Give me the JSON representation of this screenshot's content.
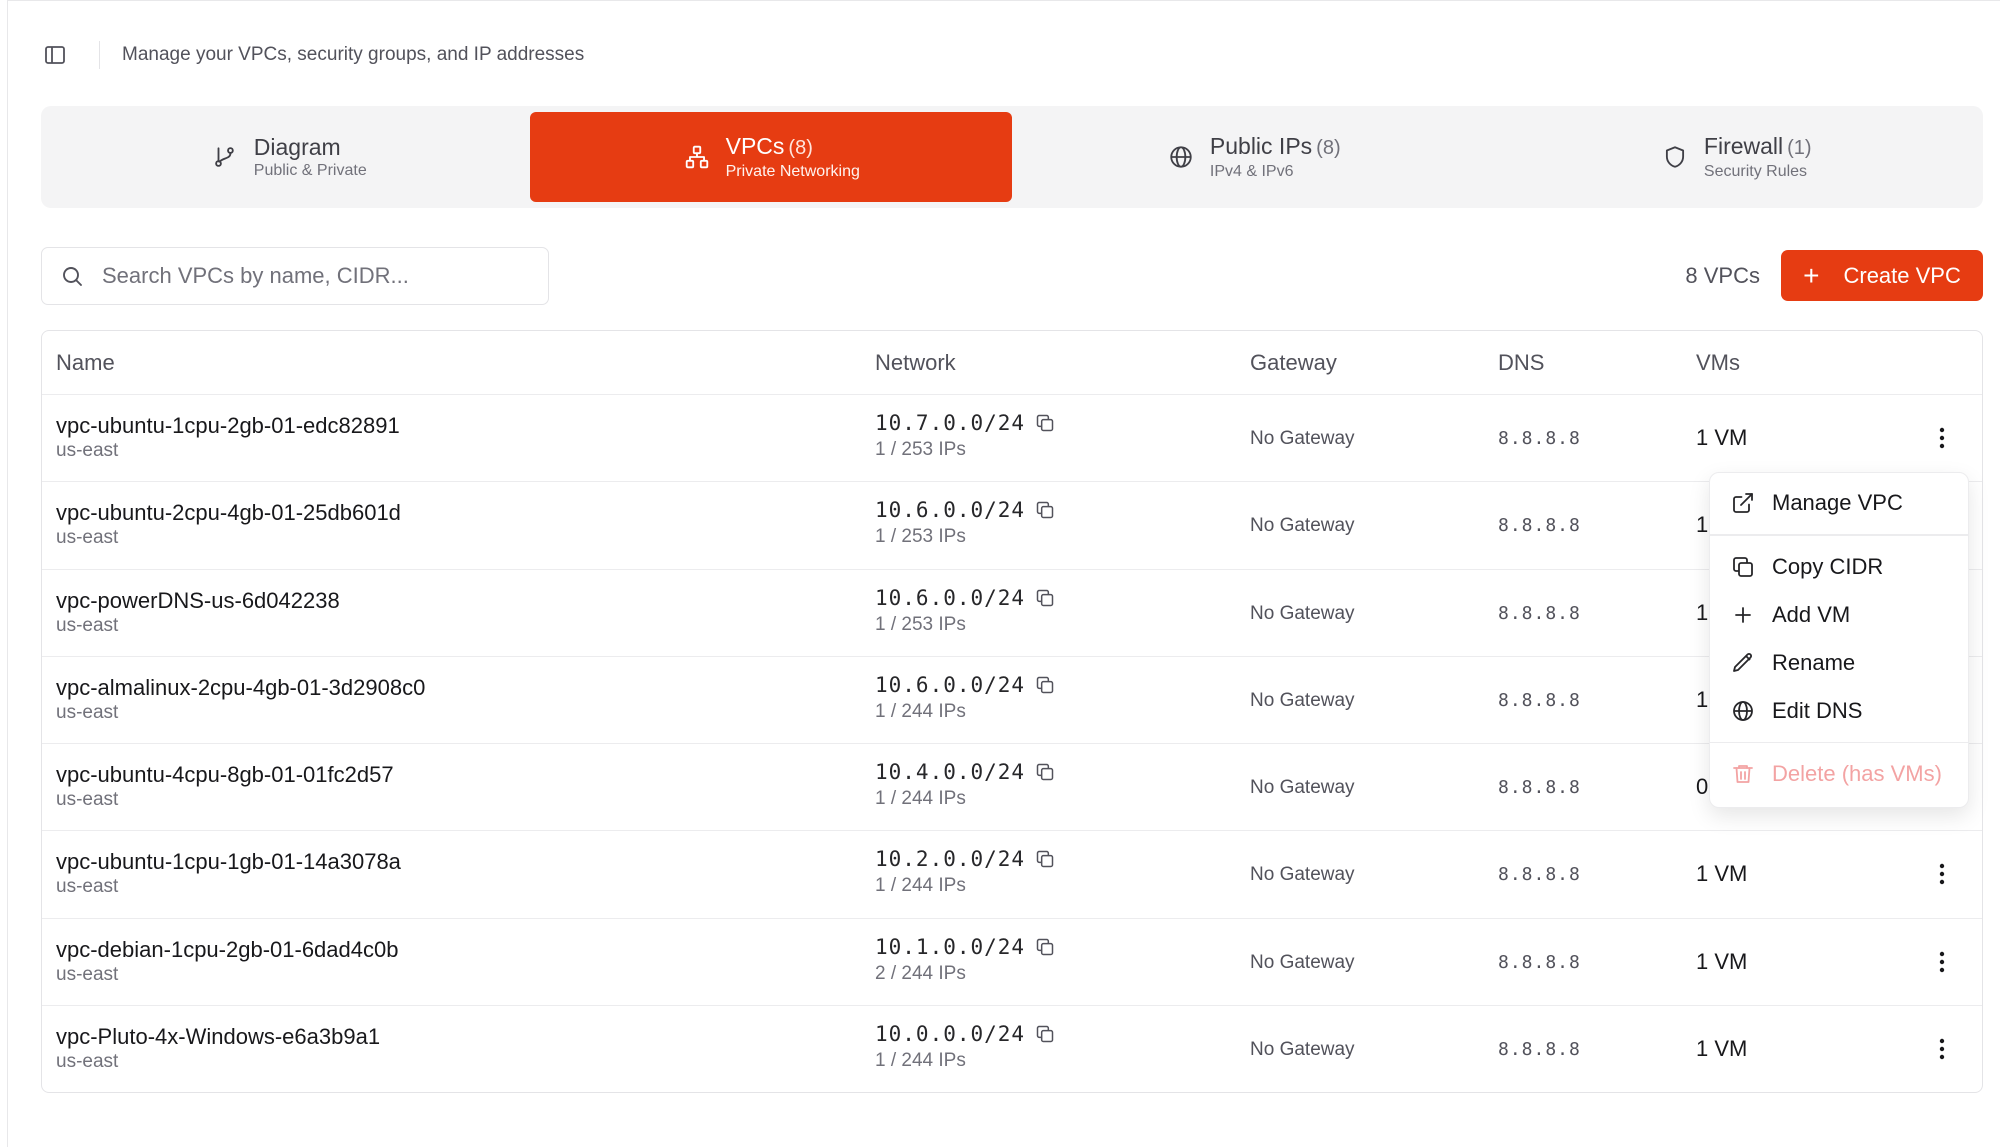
{
  "header": {
    "description": "Manage your VPCs, security groups, and IP addresses"
  },
  "tabs": [
    {
      "title": "Diagram",
      "count": "",
      "subtitle": "Public & Private",
      "icon": "git-branch-icon",
      "active": false
    },
    {
      "title": "VPCs",
      "count": "(8)",
      "subtitle": "Private Networking",
      "icon": "network-icon",
      "active": true
    },
    {
      "title": "Public IPs",
      "count": "(8)",
      "subtitle": "IPv4 & IPv6",
      "icon": "globe-icon",
      "active": false
    },
    {
      "title": "Firewall",
      "count": "(1)",
      "subtitle": "Security Rules",
      "icon": "shield-icon",
      "active": false
    }
  ],
  "search": {
    "placeholder": "Search VPCs by name, CIDR...",
    "value": ""
  },
  "toolbar": {
    "vpc_count": "8 VPCs",
    "create_label": "Create VPC"
  },
  "table": {
    "columns": [
      "Name",
      "Network",
      "Gateway",
      "DNS",
      "VMs"
    ],
    "rows": [
      {
        "name": "vpc-ubuntu-1cpu-2gb-01-edc82891",
        "region": "us-east",
        "cidr": "10.7.0.0/24",
        "ips": "1 / 253 IPs",
        "gateway": "No Gateway",
        "dns": "8.8.8.8",
        "vms": "1 VM"
      },
      {
        "name": "vpc-ubuntu-2cpu-4gb-01-25db601d",
        "region": "us-east",
        "cidr": "10.6.0.0/24",
        "ips": "1 / 253 IPs",
        "gateway": "No Gateway",
        "dns": "8.8.8.8",
        "vms": "1"
      },
      {
        "name": "vpc-powerDNS-us-6d042238",
        "region": "us-east",
        "cidr": "10.6.0.0/24",
        "ips": "1 / 253 IPs",
        "gateway": "No Gateway",
        "dns": "8.8.8.8",
        "vms": "1"
      },
      {
        "name": "vpc-almalinux-2cpu-4gb-01-3d2908c0",
        "region": "us-east",
        "cidr": "10.6.0.0/24",
        "ips": "1 / 244 IPs",
        "gateway": "No Gateway",
        "dns": "8.8.8.8",
        "vms": "1"
      },
      {
        "name": "vpc-ubuntu-4cpu-8gb-01-01fc2d57",
        "region": "us-east",
        "cidr": "10.4.0.0/24",
        "ips": "1 / 244 IPs",
        "gateway": "No Gateway",
        "dns": "8.8.8.8",
        "vms": "0"
      },
      {
        "name": "vpc-ubuntu-1cpu-1gb-01-14a3078a",
        "region": "us-east",
        "cidr": "10.2.0.0/24",
        "ips": "1 / 244 IPs",
        "gateway": "No Gateway",
        "dns": "8.8.8.8",
        "vms": "1 VM"
      },
      {
        "name": "vpc-debian-1cpu-2gb-01-6dad4c0b",
        "region": "us-east",
        "cidr": "10.1.0.0/24",
        "ips": "2 / 244 IPs",
        "gateway": "No Gateway",
        "dns": "8.8.8.8",
        "vms": "1 VM"
      },
      {
        "name": "vpc-Pluto-4x-Windows-e6a3b9a1",
        "region": "us-east",
        "cidr": "10.0.0.0/24",
        "ips": "1 / 244 IPs",
        "gateway": "No Gateway",
        "dns": "8.8.8.8",
        "vms": "1 VM"
      }
    ]
  },
  "context_menu": {
    "items": [
      {
        "label": "Manage VPC",
        "icon": "external-link-icon"
      },
      {
        "label": "Copy CIDR",
        "icon": "copy-icon"
      },
      {
        "label": "Add VM",
        "icon": "plus-icon"
      },
      {
        "label": "Rename",
        "icon": "pencil-icon"
      },
      {
        "label": "Edit DNS",
        "icon": "globe-icon"
      },
      {
        "label": "Delete (has VMs)",
        "icon": "trash-icon",
        "disabled": true
      }
    ]
  },
  "colors": {
    "accent": "#e63c12",
    "disabled_text": "#f3a3a3"
  }
}
